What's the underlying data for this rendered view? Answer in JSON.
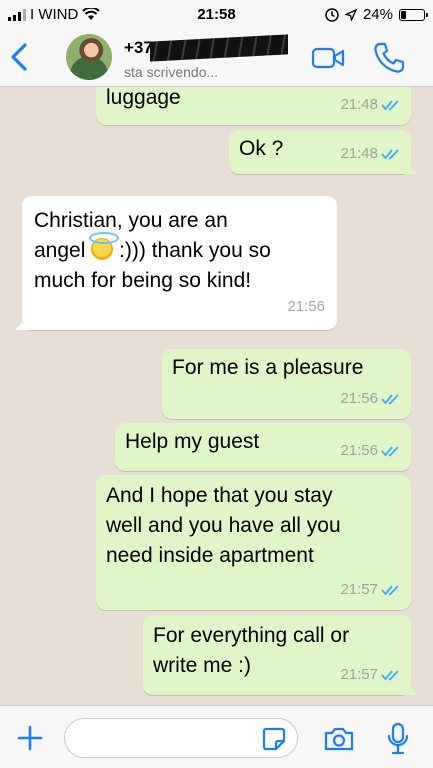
{
  "status_bar": {
    "carrier": "I WIND",
    "time": "21:58",
    "battery": "24%",
    "battery_level": 0.24
  },
  "header": {
    "contact_name": "+37",
    "subtitle": "sta scrivendo..."
  },
  "messages": [
    {
      "direction": "out",
      "text": "luggage",
      "time": "21:48",
      "status": "read"
    },
    {
      "direction": "out",
      "text": "Ok ?",
      "time": "21:48",
      "status": "read"
    },
    {
      "direction": "in",
      "lines": [
        "Christian, you are an",
        "angel",
        ":))) thank you so",
        "much for being so kind!"
      ],
      "time": "21:56"
    },
    {
      "direction": "out",
      "text": "For me is a pleasure",
      "time": "21:56",
      "status": "read"
    },
    {
      "direction": "out",
      "text": "Help my guest",
      "time": "21:56",
      "status": "read"
    },
    {
      "direction": "out",
      "lines": [
        "And I hope that you stay",
        "well and you have all you",
        "need inside apartment"
      ],
      "time": "21:57",
      "status": "read"
    },
    {
      "direction": "out",
      "lines": [
        "For everything call or",
        "write me :)"
      ],
      "time": "21:57",
      "status": "read"
    }
  ],
  "input": {
    "placeholder": "",
    "value": ""
  },
  "colors": {
    "accent": "#1a7cf6",
    "outgoing_bubble": "#e1f6c8",
    "incoming_bubble": "#ffffff",
    "read_tick": "#3fa9f5"
  },
  "icons": [
    "signal-icon",
    "wifi-icon",
    "alarm-icon",
    "location-icon",
    "battery-icon",
    "back-chevron-icon",
    "video-call-icon",
    "phone-icon",
    "plus-icon",
    "sticker-icon",
    "camera-icon",
    "microphone-icon",
    "read-ticks-icon",
    "smiling-angel-emoji"
  ]
}
